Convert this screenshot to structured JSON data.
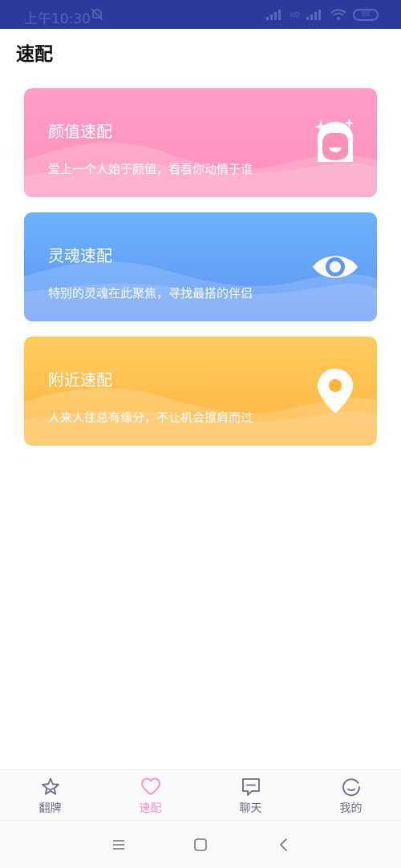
{
  "status": {
    "time": "上午10:30",
    "signal_label": "HD",
    "battery": "98"
  },
  "header": {
    "title": "速配"
  },
  "cards": [
    {
      "title": "颜值速配",
      "subtitle": "爱上一个人始于颜值，看看你动情于谁",
      "icon": "girl-face-icon"
    },
    {
      "title": "灵魂速配",
      "subtitle": "特别的灵魂在此聚焦，寻找最搭的伴侣",
      "icon": "eye-icon"
    },
    {
      "title": "附近速配",
      "subtitle": "人来人往总有缘分，不让机会擦肩而过",
      "icon": "location-pin-icon"
    }
  ],
  "tabs": [
    {
      "label": "翻牌",
      "icon": "star-icon",
      "active": false
    },
    {
      "label": "速配",
      "icon": "heart-icon",
      "active": true
    },
    {
      "label": "聊天",
      "icon": "chat-icon",
      "active": false
    },
    {
      "label": "我的",
      "icon": "smile-icon",
      "active": false
    }
  ],
  "colors": {
    "accent": "#ff8cc4",
    "tab_inactive": "#6b6e86",
    "status_bar": "#2c3a9e"
  }
}
